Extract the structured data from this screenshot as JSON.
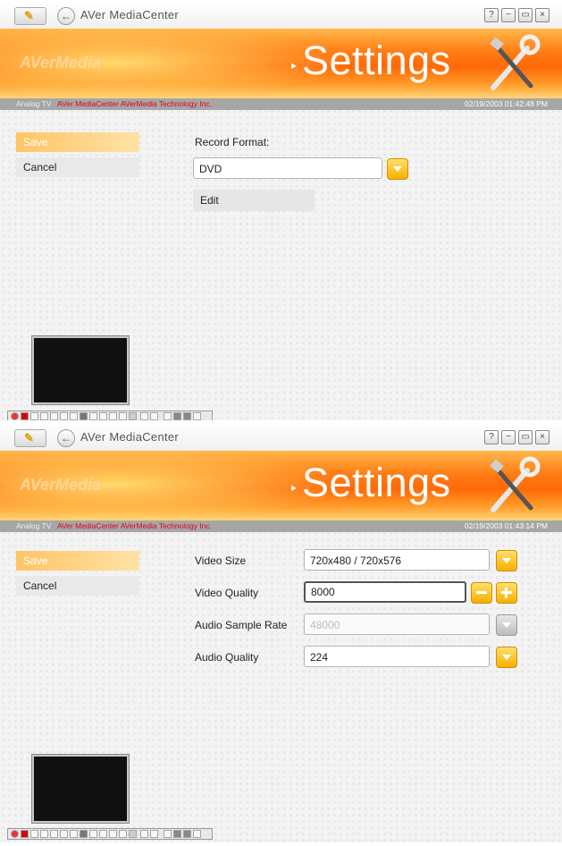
{
  "app": {
    "name": "AVer MediaCenter",
    "brand": "AVerMedia"
  },
  "window_buttons": {
    "help": "?",
    "minimize": "−",
    "restore": "▭",
    "close": "×"
  },
  "banner": {
    "title": "Settings"
  },
  "colors": {
    "accent_orange": "#ff7a12",
    "path_red": "#e8001a",
    "statusbar_gray": "#a6a6a6",
    "dropdown_yellow": "#f6b000"
  },
  "screen1": {
    "statusbar": {
      "source": "Analog TV",
      "path": "AVer MediaCenter AVerMedia Technology Inc.",
      "datetime": "02/19/2003 01:42:48 PM"
    },
    "sidebar": {
      "save_label": "Save",
      "cancel_label": "Cancel"
    },
    "record_format": {
      "label": "Record Format:",
      "value": "DVD",
      "edit_label": "Edit"
    }
  },
  "screen2": {
    "statusbar": {
      "source": "Analog TV",
      "path": "AVer MediaCenter AVerMedia Technology Inc.",
      "datetime": "02/19/2003 01:43:14 PM"
    },
    "sidebar": {
      "save_label": "Save",
      "cancel_label": "Cancel"
    },
    "fields": {
      "video_size": {
        "label": "Video Size",
        "value": "720x480 / 720x576"
      },
      "video_quality": {
        "label": "Video Quality",
        "value": "8000"
      },
      "audio_sample_rate": {
        "label": "Audio Sample Rate",
        "value": "48000"
      },
      "audio_quality": {
        "label": "Audio Quality",
        "value": "224"
      }
    }
  }
}
